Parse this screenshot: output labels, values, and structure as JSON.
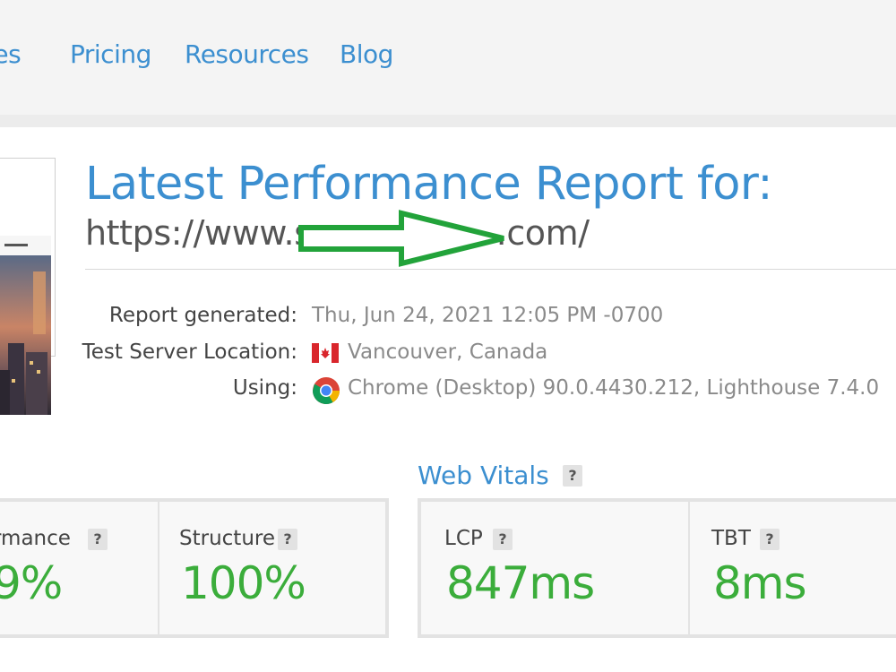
{
  "nav": {
    "items": [
      "res",
      "Pricing",
      "Resources",
      "Blog"
    ]
  },
  "report": {
    "title": "Latest Performance Report for:",
    "url_prefix": "https://www.s",
    "url_suffix": ".com/",
    "generated_label": "Report generated:",
    "generated_value": "Thu, Jun 24, 2021 12:05 PM -0700",
    "location_label": "Test Server Location:",
    "location_value": "Vancouver, Canada",
    "using_label": "Using:",
    "using_value": "Chrome (Desktop) 90.0.4430.212, Lighthouse 7.4.0"
  },
  "web_vitals": {
    "title": "Web Vitals",
    "help": "?"
  },
  "grades": [
    {
      "label": "rmance",
      "value": "9%",
      "help": "?"
    },
    {
      "label": "Structure",
      "value": "100%",
      "help": "?"
    }
  ],
  "vitals": [
    {
      "label": "LCP",
      "value": "847ms",
      "help": "?"
    },
    {
      "label": "TBT",
      "value": "8ms",
      "help": "?"
    }
  ],
  "colors": {
    "accent": "#3c8fd0",
    "good": "#3bad3b",
    "annotation_arrow": "#22a33a"
  },
  "icons": [
    "canada-flag-icon",
    "chrome-icon",
    "annotation-arrow-icon"
  ]
}
